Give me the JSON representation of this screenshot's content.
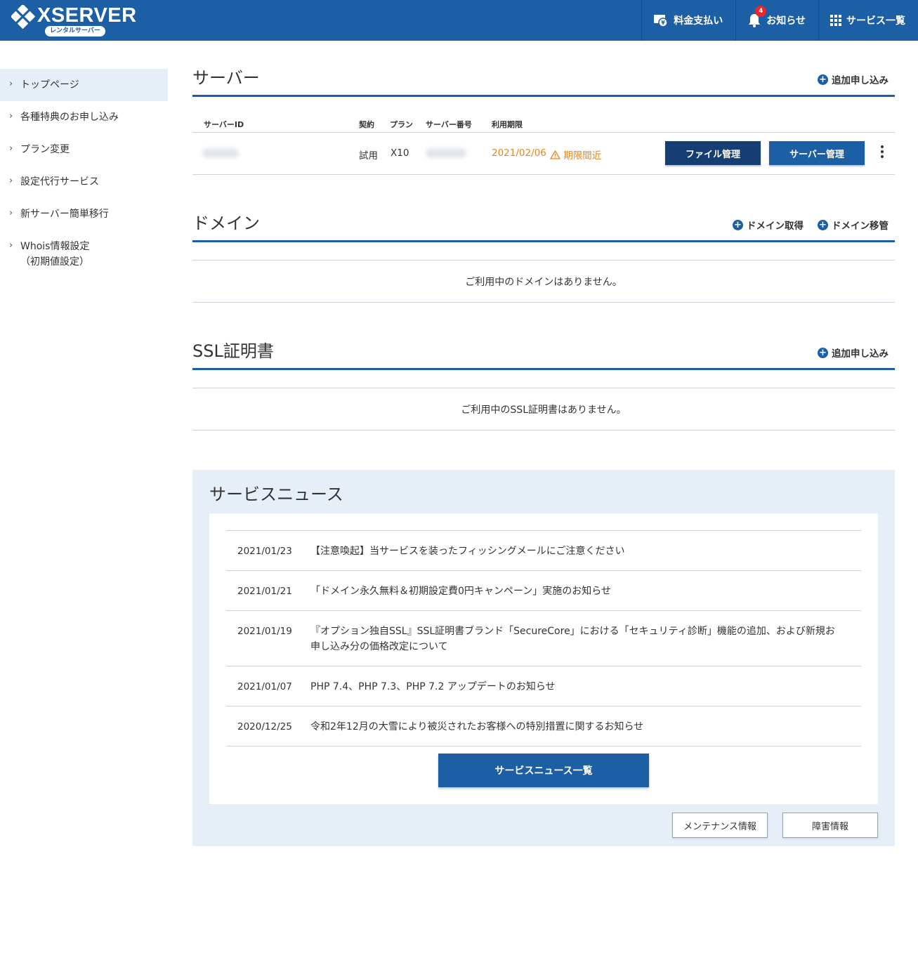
{
  "header": {
    "logo_text": "XSERVER",
    "logo_badge": "レンタルサーバー",
    "nav": [
      {
        "label": "料金支払い"
      },
      {
        "label": "お知らせ",
        "badge": "4"
      },
      {
        "label": "サービス一覧"
      }
    ]
  },
  "sidebar": {
    "items": [
      {
        "label": "トップページ",
        "active": true
      },
      {
        "label": "各種特典のお申し込み"
      },
      {
        "label": "プラン変更"
      },
      {
        "label": "設定代行サービス"
      },
      {
        "label": "新サーバー簡単移行"
      },
      {
        "label": "Whois情報設定",
        "sub": "（初期値設定）"
      }
    ]
  },
  "server": {
    "title": "サーバー",
    "action": "追加申し込み",
    "columns": {
      "id": "サーバーID",
      "contract": "契約",
      "plan": "プラン",
      "number": "サーバー番号",
      "expiry": "利用期限"
    },
    "row": {
      "contract": "試用",
      "plan": "X10",
      "expiry": "2021/02/06",
      "warning": "期限間近",
      "file_button": "ファイル管理",
      "manage_button": "サーバー管理"
    }
  },
  "domain": {
    "title": "ドメイン",
    "actions": [
      "ドメイン取得",
      "ドメイン移管"
    ],
    "empty": "ご利用中のドメインはありません。"
  },
  "ssl": {
    "title": "SSL証明書",
    "action": "追加申し込み",
    "empty": "ご利用中のSSL証明書はありません。"
  },
  "news": {
    "title": "サービスニュース",
    "items": [
      {
        "date": "2021/01/23",
        "text": "【注意喚起】当サービスを装ったフィッシングメールにご注意ください"
      },
      {
        "date": "2021/01/21",
        "text": "「ドメイン永久無料＆初期設定費0円キャンペーン」実施のお知らせ"
      },
      {
        "date": "2021/01/19",
        "text": "『オプション独自SSL』SSL証明書ブランド「SecureCore」における「セキュリティ診断」機能の追加、および新規お申し込み分の価格改定について"
      },
      {
        "date": "2021/01/07",
        "text": "PHP 7.4、PHP 7.3、PHP 7.2 アップデートのお知らせ"
      },
      {
        "date": "2020/12/25",
        "text": "令和2年12月の大雪により被災されたお客様への特別措置に関するお知らせ"
      }
    ],
    "all_button": "サービスニュース一覧",
    "maintenance_button": "メンテナンス情報",
    "failure_button": "障害情報"
  },
  "colors": {
    "primary": "#1c5fa5",
    "dark": "#163e72",
    "warning": "#e8861d",
    "badge": "#e8262b",
    "light_bg": "#e6eef7"
  }
}
